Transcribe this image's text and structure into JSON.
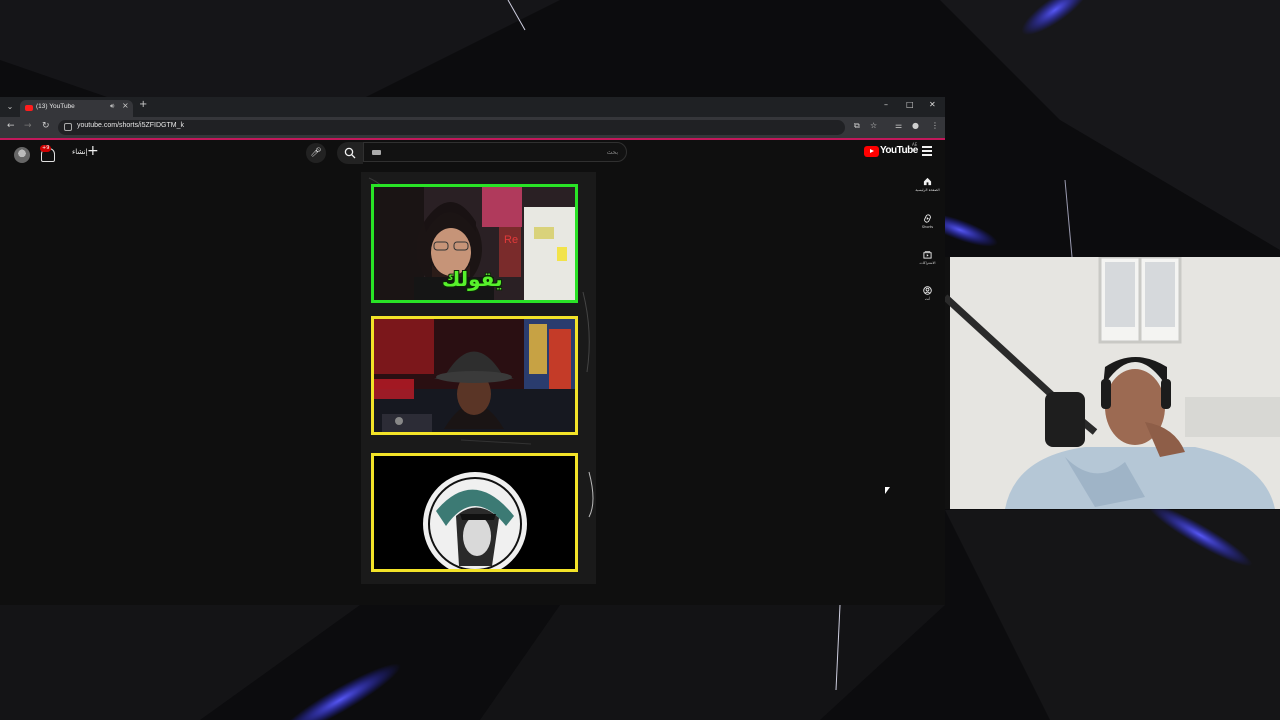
{
  "browser": {
    "tab_title": "(13) YouTube",
    "url": "youtube.com/shorts/i5ZFIDGTM_k",
    "window_controls": [
      "–",
      "□",
      "✕"
    ]
  },
  "youtube": {
    "notification_count": "+9",
    "create_label": "إنشاء",
    "search_placeholder": "بحث",
    "logo_text": "YouTube",
    "region": "AE",
    "guide": [
      {
        "label": "الصفحة الرئيسية",
        "icon": "home-icon"
      },
      {
        "label": "Shorts",
        "icon": "shorts-icon"
      },
      {
        "label": "الاشتراكات",
        "icon": "subscriptions-icon"
      },
      {
        "label": "أنت",
        "icon": "you-icon"
      }
    ]
  },
  "short": {
    "caption": "يقولك"
  },
  "colors": {
    "panel_green": "#29e326",
    "panel_yellow": "#f3e328",
    "youtube_red": "#ff0000",
    "accent_magenta": "#c2185b"
  }
}
